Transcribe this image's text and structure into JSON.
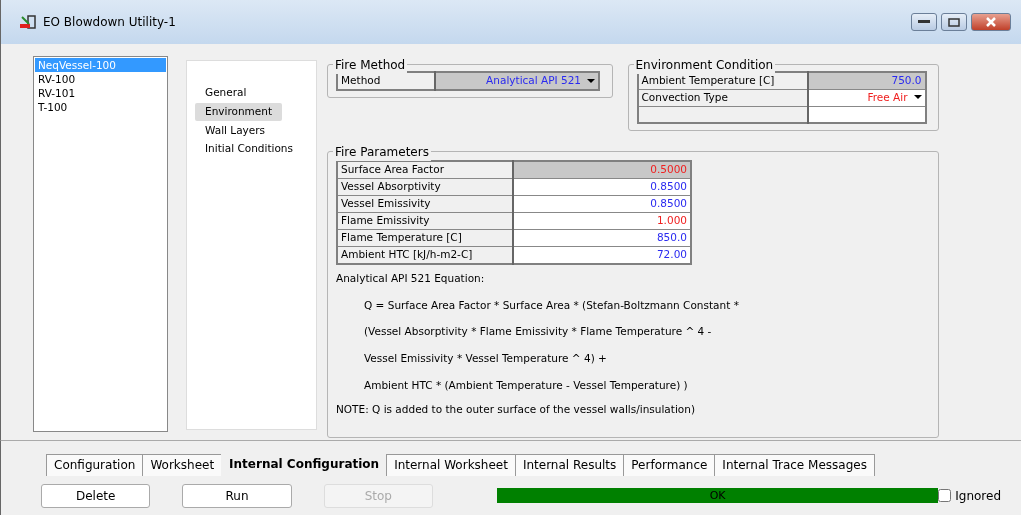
{
  "window": {
    "title": "EO Blowdown Utility-1"
  },
  "vessels": [
    {
      "label": "NeqVessel-100",
      "selected": true
    },
    {
      "label": "RV-100",
      "selected": false
    },
    {
      "label": "RV-101",
      "selected": false
    },
    {
      "label": "T-100",
      "selected": false
    }
  ],
  "sections": [
    {
      "label": "General",
      "selected": false
    },
    {
      "label": "Environment",
      "selected": true
    },
    {
      "label": "Wall Layers",
      "selected": false
    },
    {
      "label": "Initial Conditions",
      "selected": false
    }
  ],
  "fire_method": {
    "title": "Fire Method",
    "rows": [
      {
        "label": "Method",
        "value": "Analytical API 521",
        "kind": "input",
        "dropdown": true,
        "selected": true
      }
    ]
  },
  "environment": {
    "title": "Environment Condition",
    "rows": [
      {
        "label": "Ambient Temperature [C]",
        "value": "750.0",
        "kind": "input",
        "dropdown": false,
        "selected": true
      },
      {
        "label": "Convection Type",
        "value": "Free Air",
        "kind": "default",
        "dropdown": true,
        "selected": false
      }
    ]
  },
  "fire_parameters": {
    "title": "Fire Parameters",
    "rows": [
      {
        "label": "Surface Area Factor",
        "value": "0.5000",
        "kind": "default",
        "selected": true
      },
      {
        "label": "Vessel Absorptivity",
        "value": "0.8500",
        "kind": "input",
        "selected": false
      },
      {
        "label": "Vessel Emissivity",
        "value": "0.8500",
        "kind": "input",
        "selected": false
      },
      {
        "label": "Flame Emissivity",
        "value": "1.000",
        "kind": "default",
        "selected": false
      },
      {
        "label": "Flame Temperature [C]",
        "value": "850.0",
        "kind": "input",
        "selected": false
      },
      {
        "label": "Ambient HTC [kJ/h-m2-C]",
        "value": "72.00",
        "kind": "input",
        "selected": false
      }
    ],
    "equation_title": "Analytical API 521 Equation:",
    "equation_lines": [
      "Q = Surface Area Factor * Surface Area * (Stefan-Boltzmann Constant *",
      "(Vessel Absorptivity * Flame Emissivity * Flame Temperature ^ 4 -",
      "Vessel Emissivity * Vessel Temperature ^ 4) +",
      "Ambient HTC * (Ambient Temperature - Vessel Temperature) )"
    ],
    "note": "NOTE: Q is added to the outer surface of the vessel walls/insulation)"
  },
  "tabs": [
    {
      "label": "Configuration",
      "selected": false
    },
    {
      "label": "Worksheet",
      "selected": false
    },
    {
      "label": "Internal Configuration",
      "selected": true
    },
    {
      "label": "Internal Worksheet",
      "selected": false
    },
    {
      "label": "Internal Results",
      "selected": false
    },
    {
      "label": "Performance",
      "selected": false
    },
    {
      "label": "Internal Trace Messages",
      "selected": false
    }
  ],
  "buttons": [
    {
      "label": "Delete",
      "disabled": false
    },
    {
      "label": "Run",
      "disabled": false
    },
    {
      "label": "Stop",
      "disabled": true
    }
  ],
  "status": {
    "label": "OK",
    "level": 1
  },
  "ignored": {
    "label": "Ignored",
    "checked": false
  }
}
